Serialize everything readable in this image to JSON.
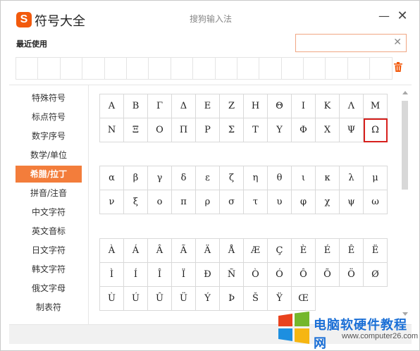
{
  "titlebar": {
    "logo_glyph": "S",
    "app_title": "符号大全",
    "ime_title": "搜狗输入法",
    "minimize": "—",
    "close": "✕",
    "brand_color": "#f25a0d"
  },
  "recent": {
    "label": "最近使用",
    "search_value": "",
    "search_clear": "✕",
    "slot_count": 17,
    "trash_icon": "trash-icon"
  },
  "sidebar": {
    "active_color": "#f37d3b",
    "items": [
      {
        "label": "特殊符号",
        "active": false
      },
      {
        "label": "标点符号",
        "active": false
      },
      {
        "label": "数字序号",
        "active": false
      },
      {
        "label": "数学/单位",
        "active": false
      },
      {
        "label": "希腊/拉丁",
        "active": true
      },
      {
        "label": "拼音/注音",
        "active": false
      },
      {
        "label": "中文字符",
        "active": false
      },
      {
        "label": "英文音标",
        "active": false
      },
      {
        "label": "日文字符",
        "active": false
      },
      {
        "label": "韩文字符",
        "active": false
      },
      {
        "label": "俄文字母",
        "active": false
      },
      {
        "label": "制表符",
        "active": false
      }
    ]
  },
  "symbols": {
    "selected": "Ω",
    "selected_color": "#d7201d",
    "greek_upper": [
      "Α",
      "Β",
      "Γ",
      "Δ",
      "Ε",
      "Ζ",
      "Η",
      "Θ",
      "Ι",
      "Κ",
      "Λ",
      "Μ",
      "Ν",
      "Ξ",
      "Ο",
      "Π",
      "Ρ",
      "Σ",
      "Τ",
      "Υ",
      "Φ",
      "Χ",
      "Ψ",
      "Ω"
    ],
    "greek_lower": [
      "α",
      "β",
      "γ",
      "δ",
      "ε",
      "ζ",
      "η",
      "θ",
      "ι",
      "κ",
      "λ",
      "μ",
      "ν",
      "ξ",
      "ο",
      "π",
      "ρ",
      "σ",
      "τ",
      "υ",
      "φ",
      "χ",
      "ψ",
      "ω"
    ],
    "latin": [
      "À",
      "Á",
      "Â",
      "Ã",
      "Ä",
      "Å",
      "Æ",
      "Ç",
      "È",
      "É",
      "Ê",
      "Ë",
      "Ì",
      "Í",
      "Î",
      "Ï",
      "Ð",
      "Ñ",
      "Ò",
      "Ó",
      "Ô",
      "Õ",
      "Ö",
      "Ø",
      "Ù",
      "Ú",
      "Û",
      "Ü",
      "Ý",
      "Þ",
      "Š",
      "Ÿ",
      "Œ"
    ]
  },
  "watermark": {
    "text": "电脑软硬件教程网",
    "url": "www.computer26.com"
  }
}
